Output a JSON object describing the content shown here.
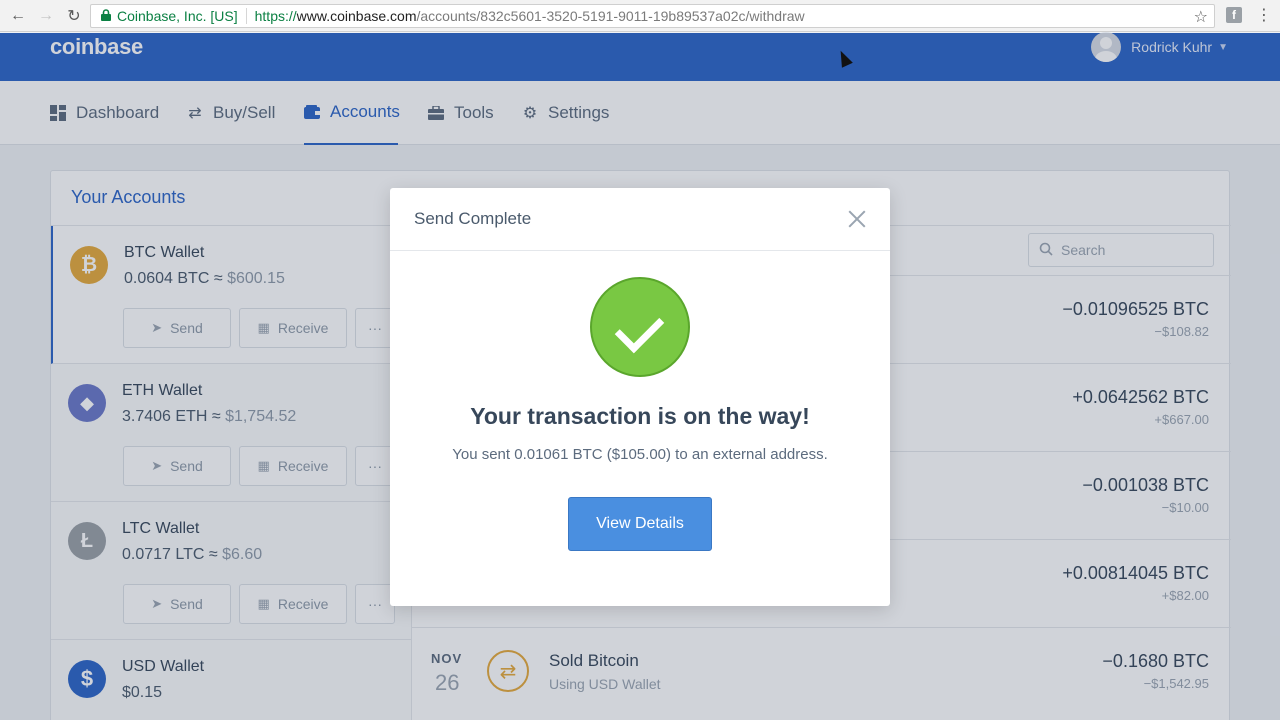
{
  "browser": {
    "secure_label": "Coinbase, Inc. [US]",
    "url_proto": "https://",
    "url_host": "www.coinbase.com",
    "url_path": "/accounts/832c5601-3520-5191-9011-19b89537a02c/withdraw"
  },
  "header": {
    "logo": "coinbase",
    "user_name": "Rodrick Kuhr"
  },
  "nav": {
    "tabs": [
      {
        "label": "Dashboard",
        "icon": "dashboard-icon"
      },
      {
        "label": "Buy/Sell",
        "icon": "swap-icon"
      },
      {
        "label": "Accounts",
        "icon": "wallet-icon"
      },
      {
        "label": "Tools",
        "icon": "toolbox-icon"
      },
      {
        "label": "Settings",
        "icon": "gear-icon"
      }
    ],
    "active": "Accounts"
  },
  "accounts": {
    "title": "Your Accounts",
    "wallets": [
      {
        "name": "BTC Wallet",
        "amount": "0.0604 BTC ≈",
        "usd": "$600.15",
        "symbol": "₿",
        "color": "#e6a93a"
      },
      {
        "name": "ETH Wallet",
        "amount": "3.7406 ETH ≈",
        "usd": "$1,754.52",
        "symbol": "◆",
        "color": "#6a78c8"
      },
      {
        "name": "LTC Wallet",
        "amount": "0.0717 LTC ≈",
        "usd": "$6.60",
        "symbol": "Ł",
        "color": "#9aa0a6"
      },
      {
        "name": "USD Wallet",
        "amount": "$0.15",
        "usd": "",
        "symbol": "$",
        "color": "#2b64c7"
      }
    ],
    "buttons": {
      "send": "Send",
      "receive": "Receive",
      "more": "···"
    }
  },
  "transactions": {
    "search_placeholder": "Search",
    "items": [
      {
        "amount": "−0.01096525 BTC",
        "usd": "−$108.82"
      },
      {
        "amount": "+0.0642562 BTC",
        "usd": "+$667.00"
      },
      {
        "amount": "−0.001038 BTC",
        "usd": "−$10.00"
      },
      {
        "amount": "+0.00814045 BTC",
        "usd": "+$82.00"
      },
      {
        "amount": "−0.1680 BTC",
        "usd": "−$1,542.95",
        "month": "NOV",
        "day": "26",
        "title": "Sold Bitcoin",
        "subtitle": "Using USD Wallet"
      }
    ]
  },
  "modal": {
    "title": "Send Complete",
    "heading": "Your transaction is on the way!",
    "message": "You sent 0.01061 BTC ($105.00) to an external address.",
    "button": "View Details"
  }
}
